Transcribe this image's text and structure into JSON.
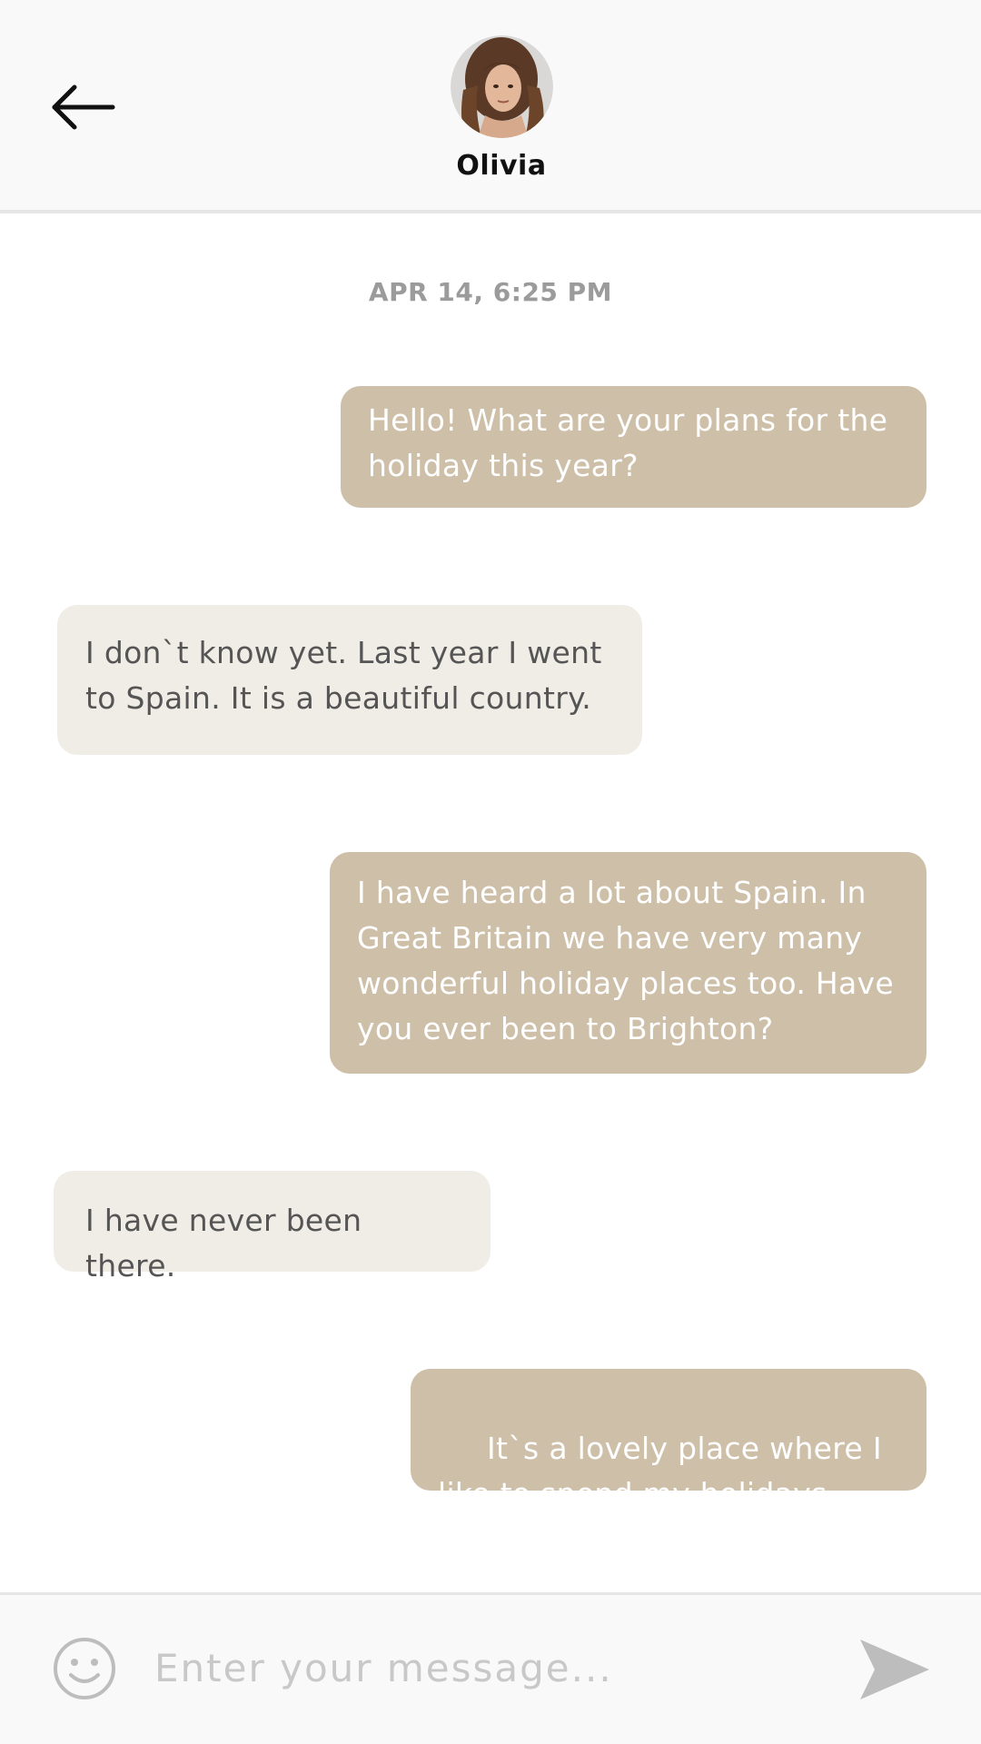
{
  "header": {
    "contact_name": "Olivia"
  },
  "chat": {
    "timestamp": "APR 14, 6:25 PM",
    "messages": [
      {
        "direction": "sent",
        "text": "Hello! What are your plans for the holiday this year?"
      },
      {
        "direction": "received",
        "text": "I don`t know yet. Last year I went to Spain. It is a beautiful country."
      },
      {
        "direction": "sent",
        "text": "I have heard a lot about Spain. In Great Britain we have very many wonderful holiday places too. Have you ever been to Brighton?"
      },
      {
        "direction": "received",
        "text": "I have never been there."
      },
      {
        "direction": "sent",
        "text": " It`s a lovely place where I like to spend my holidays."
      }
    ]
  },
  "composer": {
    "value": "",
    "placeholder": "Enter your message...",
    "emoji_icon": "smiley-icon",
    "send_icon": "send-arrow-icon"
  },
  "colors": {
    "sent_bubble": "#cebfa8",
    "received_bubble": "#f0ede6",
    "header_bg": "#f9f9f9",
    "timestamp": "#9b9b9b",
    "icon_gray": "#bdbdbd"
  }
}
